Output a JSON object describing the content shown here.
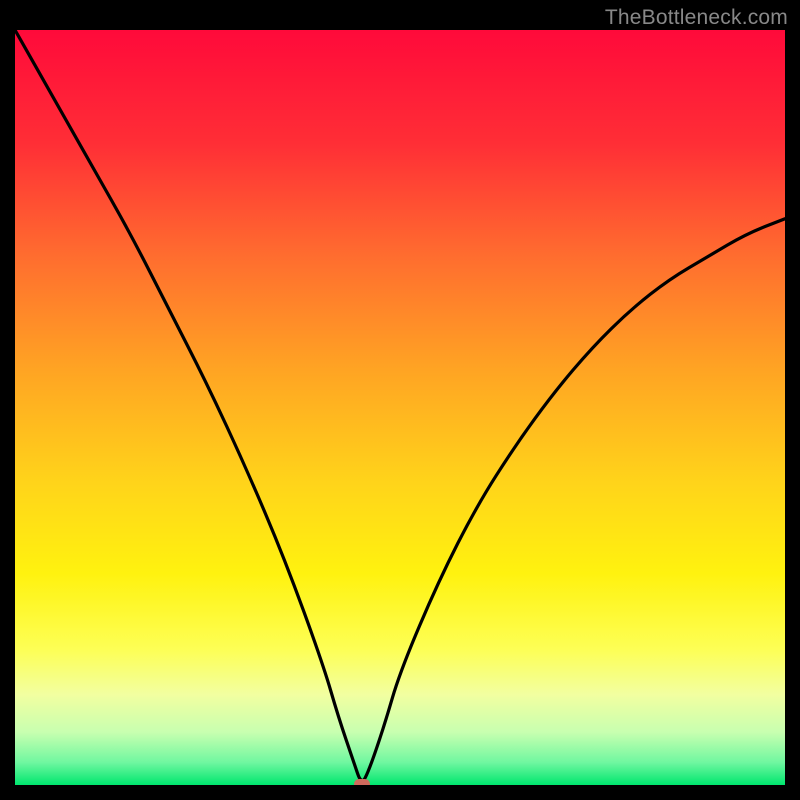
{
  "watermark": "TheBottleneck.com",
  "chart_data": {
    "type": "line",
    "title": "",
    "xlabel": "",
    "ylabel": "",
    "xlim": [
      0,
      100
    ],
    "ylim": [
      0,
      100
    ],
    "x": [
      0,
      5,
      10,
      15,
      20,
      25,
      30,
      35,
      40,
      42,
      44,
      45,
      46,
      48,
      50,
      55,
      60,
      65,
      70,
      75,
      80,
      85,
      90,
      95,
      100
    ],
    "y": [
      100,
      91,
      82,
      73,
      63,
      53,
      42,
      30,
      16,
      9,
      3,
      0,
      2,
      8,
      15,
      27,
      37,
      45,
      52,
      58,
      63,
      67,
      70,
      73,
      75
    ],
    "marker": {
      "x": 45,
      "y": 0
    },
    "background_gradient": {
      "stops": [
        {
          "pos": 0.0,
          "color": "#ff0a3a"
        },
        {
          "pos": 0.15,
          "color": "#ff2e36"
        },
        {
          "pos": 0.3,
          "color": "#ff6d2f"
        },
        {
          "pos": 0.45,
          "color": "#ffa423"
        },
        {
          "pos": 0.6,
          "color": "#ffd41a"
        },
        {
          "pos": 0.72,
          "color": "#fff20f"
        },
        {
          "pos": 0.82,
          "color": "#fdff55"
        },
        {
          "pos": 0.88,
          "color": "#f2ffa0"
        },
        {
          "pos": 0.93,
          "color": "#c8ffb0"
        },
        {
          "pos": 0.97,
          "color": "#70f7a0"
        },
        {
          "pos": 1.0,
          "color": "#00e66e"
        }
      ]
    }
  }
}
